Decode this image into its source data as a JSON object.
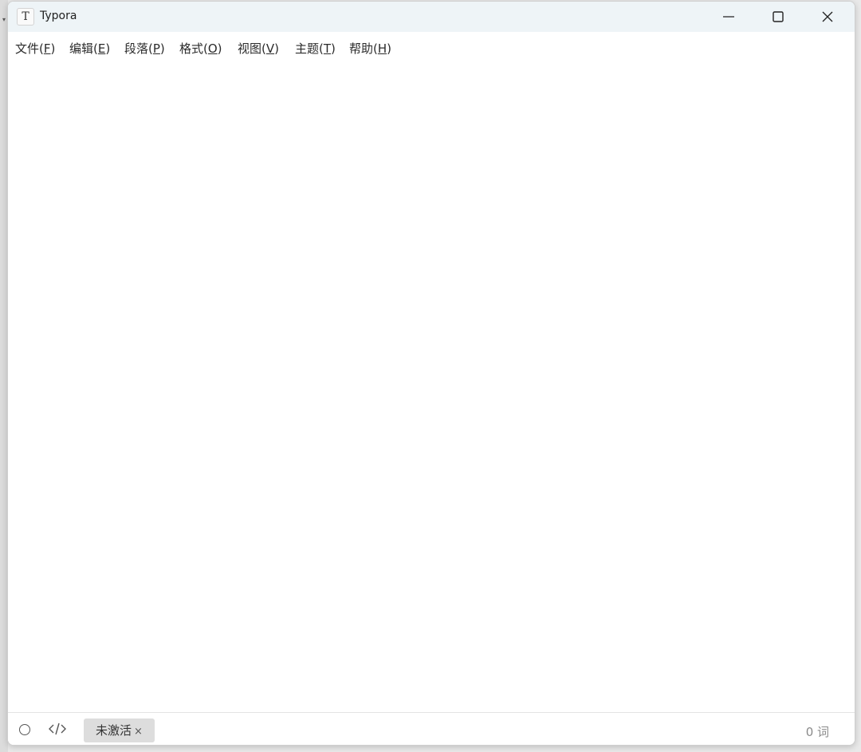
{
  "window": {
    "title": "Typora",
    "app_icon_letter": "T"
  },
  "menubar": {
    "items": [
      {
        "label": "文件(",
        "accel": "F",
        "suffix": ")"
      },
      {
        "label": "编辑(",
        "accel": "E",
        "suffix": ")"
      },
      {
        "label": "段落(",
        "accel": "P",
        "suffix": ")"
      },
      {
        "label": "格式(",
        "accel": "O",
        "suffix": ")"
      },
      {
        "label": "视图(",
        "accel": "V",
        "suffix": ")"
      },
      {
        "label": "主题(",
        "accel": "T",
        "suffix": ")"
      },
      {
        "label": "帮助(",
        "accel": "H",
        "suffix": ")"
      }
    ]
  },
  "statusbar": {
    "code_toggle": "</>",
    "badge_label": "未激活",
    "badge_close": "×",
    "word_count": "0 词"
  },
  "colors": {
    "titlebar_bg": "#eef4f7",
    "badge_bg": "#dddddd",
    "text": "#2b2b2b"
  }
}
